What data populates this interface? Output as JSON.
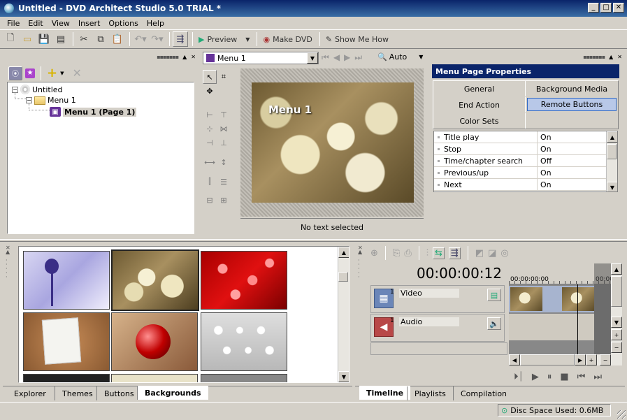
{
  "window": {
    "title": "Untitled - DVD Architect Studio 5.0 TRIAL *",
    "btn_min": "_",
    "btn_max": "□",
    "btn_close": "✕"
  },
  "menubar": [
    "File",
    "Edit",
    "View",
    "Insert",
    "Options",
    "Help"
  ],
  "toolbar": {
    "preview": "Preview",
    "make_dvd": "Make DVD",
    "show_me_how": "Show Me How"
  },
  "project": {
    "tree": {
      "root": "Untitled",
      "menu": "Menu 1",
      "page": "Menu 1 (Page 1)"
    }
  },
  "editor": {
    "menu_select": "Menu 1",
    "zoom": "Auto",
    "menu_title": "Menu 1",
    "status": "No text selected"
  },
  "props": {
    "title": "Menu Page Properties",
    "tabs": [
      "General",
      "Background Media",
      "End Action",
      "Remote Buttons",
      "Color Sets"
    ],
    "active_tab": "Remote Buttons",
    "rows": [
      {
        "k": "Title play",
        "v": "On"
      },
      {
        "k": "Stop",
        "v": "On"
      },
      {
        "k": "Time/chapter search",
        "v": "Off"
      },
      {
        "k": "Previous/up",
        "v": "On"
      },
      {
        "k": "Next",
        "v": "On"
      }
    ]
  },
  "media_tabs": [
    "Explorer",
    "Themes",
    "Buttons",
    "Backgrounds"
  ],
  "media_active": "Backgrounds",
  "timeline": {
    "timecode": "00:00:00:12",
    "ruler_start": "00:00:00:00",
    "ruler_next": "00:00",
    "track_video": "Video",
    "track_audio": "Audio",
    "track_num": "1",
    "tabs": [
      "Timeline",
      "Playlists",
      "Compilation"
    ],
    "active_tab": "Timeline"
  },
  "status": {
    "disc_space": "Disc Space Used: 0.6MB"
  },
  "colors": {
    "title_bar": "#0a246a",
    "active_prop_tab": "#b8c8e8",
    "selection": "#316ac5"
  }
}
